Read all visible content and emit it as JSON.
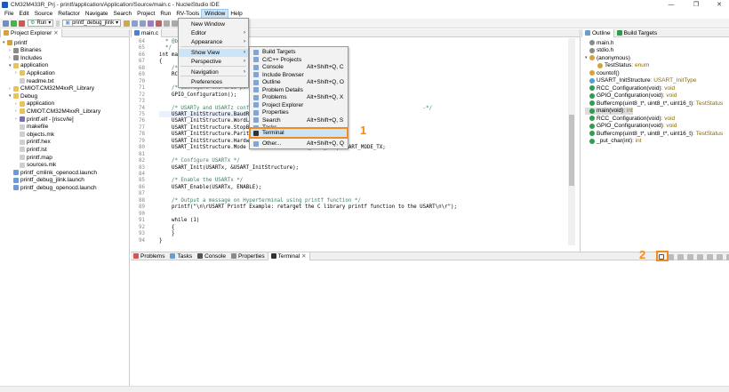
{
  "window": {
    "title": "CM32M433R_Prj - printf/application/Application/Source/main.c - NucleiStudio IDE",
    "minimize": "—",
    "maximize": "❐",
    "close": "✕"
  },
  "menubar": [
    "File",
    "Edit",
    "Source",
    "Refactor",
    "Navigate",
    "Search",
    "Project",
    "Run",
    "RV-Tools",
    "Window",
    "Help"
  ],
  "toolbar": {
    "run_mode": "Run",
    "launch_config": "printf_debug_jlink"
  },
  "project_explorer": {
    "title": "Project Explorer",
    "items": [
      {
        "label": "printf",
        "depth": 0,
        "twisty": "v",
        "color": "#d8a23a"
      },
      {
        "label": "Binaries",
        "depth": 1,
        "twisty": ">",
        "color": "#8a8a8a"
      },
      {
        "label": "Includes",
        "depth": 1,
        "twisty": ">",
        "color": "#8a8a8a"
      },
      {
        "label": "application",
        "depth": 1,
        "twisty": "v",
        "color": "#e7c35a"
      },
      {
        "label": "Application",
        "depth": 2,
        "twisty": ">",
        "color": "#e7c35a"
      },
      {
        "label": "readme.txt",
        "depth": 2,
        "twisty": "",
        "color": "#cfcfcf"
      },
      {
        "label": "CMIOT.CM32M4xxR_Library",
        "depth": 1,
        "twisty": ">",
        "color": "#e7c35a"
      },
      {
        "label": "Debug",
        "depth": 1,
        "twisty": "v",
        "color": "#e7c35a"
      },
      {
        "label": "application",
        "depth": 2,
        "twisty": ">",
        "color": "#e7c35a"
      },
      {
        "label": "CMIOT.CM32M4xxR_Library",
        "depth": 2,
        "twisty": ">",
        "color": "#e7c35a"
      },
      {
        "label": "printf.elf - [riscv/le]",
        "depth": 2,
        "twisty": ">",
        "color": "#7a6fb0"
      },
      {
        "label": "makefile",
        "depth": 2,
        "twisty": "",
        "color": "#cfcfcf"
      },
      {
        "label": "objects.mk",
        "depth": 2,
        "twisty": "",
        "color": "#cfcfcf"
      },
      {
        "label": "printf.hex",
        "depth": 2,
        "twisty": "",
        "color": "#cfcfcf"
      },
      {
        "label": "printf.lst",
        "depth": 2,
        "twisty": "",
        "color": "#cfcfcf"
      },
      {
        "label": "printf.map",
        "depth": 2,
        "twisty": "",
        "color": "#cfcfcf"
      },
      {
        "label": "sources.mk",
        "depth": 2,
        "twisty": "",
        "color": "#cfcfcf"
      },
      {
        "label": "printf_cmlink_openocd.launch",
        "depth": 1,
        "twisty": "",
        "color": "#6c9bd6"
      },
      {
        "label": "printf_debug_jlink.launch",
        "depth": 1,
        "twisty": "",
        "color": "#6c9bd6"
      },
      {
        "label": "printf_debug_openocd.launch",
        "depth": 1,
        "twisty": "",
        "color": "#6c9bd6"
      }
    ]
  },
  "editor": {
    "tab": "main.c",
    "lines": [
      {
        "n": "64",
        "text": "  * @brief M"
      },
      {
        "n": "65",
        "text": "  */"
      },
      {
        "n": "66",
        "text": "int main(v"
      },
      {
        "n": "67",
        "text": "{"
      },
      {
        "n": "68",
        "text": "    /* Syst"
      },
      {
        "n": "69",
        "text": "    RCC_Con"
      },
      {
        "n": "70",
        "text": ""
      },
      {
        "n": "71",
        "text": "    /* Configure the GPIO port"
      },
      {
        "n": "72",
        "text": "    GPIO_Configuration();"
      },
      {
        "n": "73",
        "text": ""
      },
      {
        "n": "74",
        "text": "    /* USARTy and USARTz config                                                      -*/"
      },
      {
        "n": "75",
        "text": "    USART_InitStructure.BaudRa"
      },
      {
        "n": "76",
        "text": "    USART_InitStructure.WordLe"
      },
      {
        "n": "77",
        "text": "    USART_InitStructure.StopBi"
      },
      {
        "n": "78",
        "text": "    USART_InitStructure.Parity"
      },
      {
        "n": "79",
        "text": "    USART_InitStructure.Hardwa"
      },
      {
        "n": "80",
        "text": "    USART_InitStructure.Mode             = USART_MODE_RX | USART_MODE_TX;"
      },
      {
        "n": "81",
        "text": ""
      },
      {
        "n": "82",
        "text": "    /* Configure USARTx */"
      },
      {
        "n": "83",
        "text": "    USART_Init(USARTx, &USART_InitStructure);"
      },
      {
        "n": "84",
        "text": ""
      },
      {
        "n": "85",
        "text": "    /* Enable the USARTx */"
      },
      {
        "n": "86",
        "text": "    USART_Enable(USARTx, ENABLE);"
      },
      {
        "n": "87",
        "text": ""
      },
      {
        "n": "88",
        "text": "    /* Output a message on Hyperterminal using printf function */"
      },
      {
        "n": "89",
        "text": "    printf(\"\\n\\rUSART Printf Example: retarget the C library printf function to the USART\\n\\r\");"
      },
      {
        "n": "90",
        "text": ""
      },
      {
        "n": "91",
        "text": "    while (1)"
      },
      {
        "n": "92",
        "text": "    {"
      },
      {
        "n": "93",
        "text": "    }"
      },
      {
        "n": "94",
        "text": "}"
      }
    ]
  },
  "window_menu": {
    "items": [
      {
        "label": "New Window",
        "arrow": false
      },
      {
        "label": "Editor",
        "arrow": true
      },
      {
        "label": "Appearance",
        "arrow": true
      },
      {
        "label": "Show View",
        "arrow": true,
        "selected": true
      },
      {
        "label": "Perspective",
        "arrow": true
      },
      {
        "label": "Navigation",
        "arrow": true
      },
      {
        "label": "Preferences",
        "arrow": false
      }
    ]
  },
  "show_view_menu": {
    "items": [
      {
        "label": "Build Targets",
        "shortcut": ""
      },
      {
        "label": "C/C++ Projects",
        "shortcut": ""
      },
      {
        "label": "Console",
        "shortcut": "Alt+Shift+Q, C"
      },
      {
        "label": "Include Browser",
        "shortcut": ""
      },
      {
        "label": "Outline",
        "shortcut": "Alt+Shift+Q, O"
      },
      {
        "label": "Problem Details",
        "shortcut": ""
      },
      {
        "label": "Problems",
        "shortcut": "Alt+Shift+Q, X"
      },
      {
        "label": "Project Explorer",
        "shortcut": ""
      },
      {
        "label": "Properties",
        "shortcut": ""
      },
      {
        "label": "Search",
        "shortcut": "Alt+Shift+Q, S"
      },
      {
        "label": "Tasks",
        "shortcut": ""
      },
      {
        "label": "Terminal",
        "shortcut": "",
        "highlight": true
      },
      {
        "label": "Other...",
        "shortcut": "Alt+Shift+Q, Q"
      }
    ]
  },
  "outline": {
    "tabs": [
      "Outline",
      "Build Targets"
    ],
    "items": [
      {
        "label": "main.h",
        "type": "",
        "depth": 0,
        "color": "#8a8a8a"
      },
      {
        "label": "stdio.h",
        "type": "",
        "depth": 0,
        "color": "#8a8a8a"
      },
      {
        "label": "(anonymous)",
        "type": "",
        "depth": 0,
        "color": "#d8a23a",
        "twisty": "v"
      },
      {
        "label": "TestStatus",
        "type": " : enum",
        "depth": 1,
        "color": "#d8a23a"
      },
      {
        "label": "countof()",
        "type": "",
        "depth": 0,
        "color": "#d8a23a"
      },
      {
        "label": "USART_InitStructure",
        "type": " : USART_InitType",
        "depth": 0,
        "color": "#4f9fd9"
      },
      {
        "label": "RCC_Configuration(void)",
        "type": " : void",
        "depth": 0,
        "color": "#2e9e4e"
      },
      {
        "label": "GPIO_Configuration(void)",
        "type": " : void",
        "depth": 0,
        "color": "#2e9e4e"
      },
      {
        "label": "Buffercmp(uint8_t*, uint8_t*, uint16_t)",
        "type": " : TestStatus",
        "depth": 0,
        "color": "#2e9e4e"
      },
      {
        "label": "main(void)",
        "type": " : int",
        "depth": 0,
        "color": "#2e9e4e",
        "selected": true
      },
      {
        "label": "RCC_Configuration(void)",
        "type": " : void",
        "depth": 0,
        "color": "#2e9e4e"
      },
      {
        "label": "GPIO_Configuration(void)",
        "type": " : void",
        "depth": 0,
        "color": "#2e9e4e"
      },
      {
        "label": "Buffercmp(uint8_t*, uint8_t*, uint16_t)",
        "type": " : TestStatus",
        "depth": 0,
        "color": "#2e9e4e"
      },
      {
        "label": "_put_char(int)",
        "type": " : int",
        "depth": 0,
        "color": "#2e9e4e"
      }
    ]
  },
  "bottom_tabs": [
    "Problems",
    "Tasks",
    "Console",
    "Properties",
    "Terminal"
  ],
  "callouts": {
    "one": "1",
    "two": "2"
  },
  "accent_orange": "#f28c1e"
}
